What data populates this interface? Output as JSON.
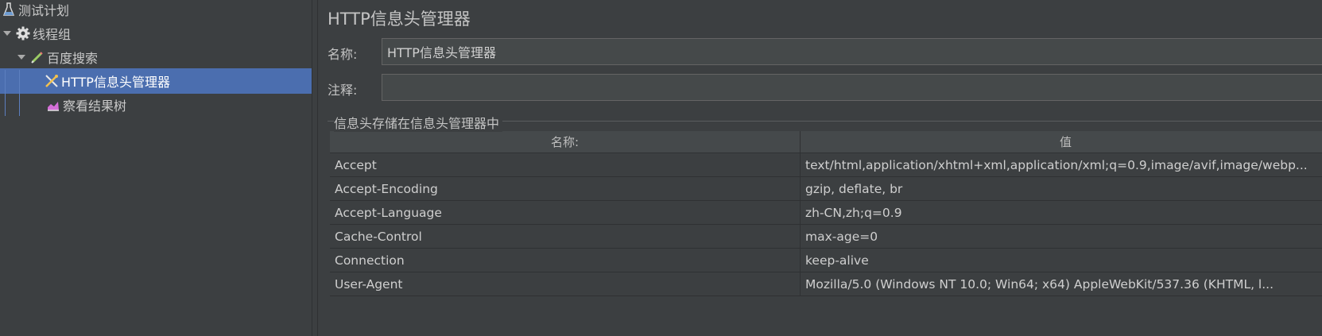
{
  "sidebar": {
    "items": [
      {
        "label": "测试计划"
      },
      {
        "label": "线程组"
      },
      {
        "label": "百度搜索"
      },
      {
        "label": "HTTP信息头管理器"
      },
      {
        "label": "察看结果树"
      }
    ]
  },
  "main": {
    "title": "HTTP信息头管理器",
    "name_label": "名称:",
    "name_value": "HTTP信息头管理器",
    "comment_label": "注释:",
    "comment_value": "",
    "group_title": "信息头存储在信息头管理器中",
    "table": {
      "headers": [
        "名称:",
        "值"
      ],
      "rows": [
        [
          "Accept",
          "text/html,application/xhtml+xml,application/xml;q=0.9,image/avif,image/webp..."
        ],
        [
          "Accept-Encoding",
          "gzip, deflate, br"
        ],
        [
          "Accept-Language",
          "zh-CN,zh;q=0.9"
        ],
        [
          "Cache-Control",
          "max-age=0"
        ],
        [
          "Connection",
          "keep-alive"
        ],
        [
          "User-Agent",
          "Mozilla/5.0 (Windows NT 10.0; Win64; x64) AppleWebKit/537.36 (KHTML, l..."
        ]
      ]
    }
  },
  "colors": {
    "background": "#3c3f41",
    "selection": "#4b6eaf",
    "table_header": "#45494b"
  },
  "icons": [
    "test-plan-flask-icon",
    "thread-group-gear-icon",
    "sampler-pen-icon",
    "header-manager-tools-icon",
    "results-tree-graph-icon"
  ]
}
